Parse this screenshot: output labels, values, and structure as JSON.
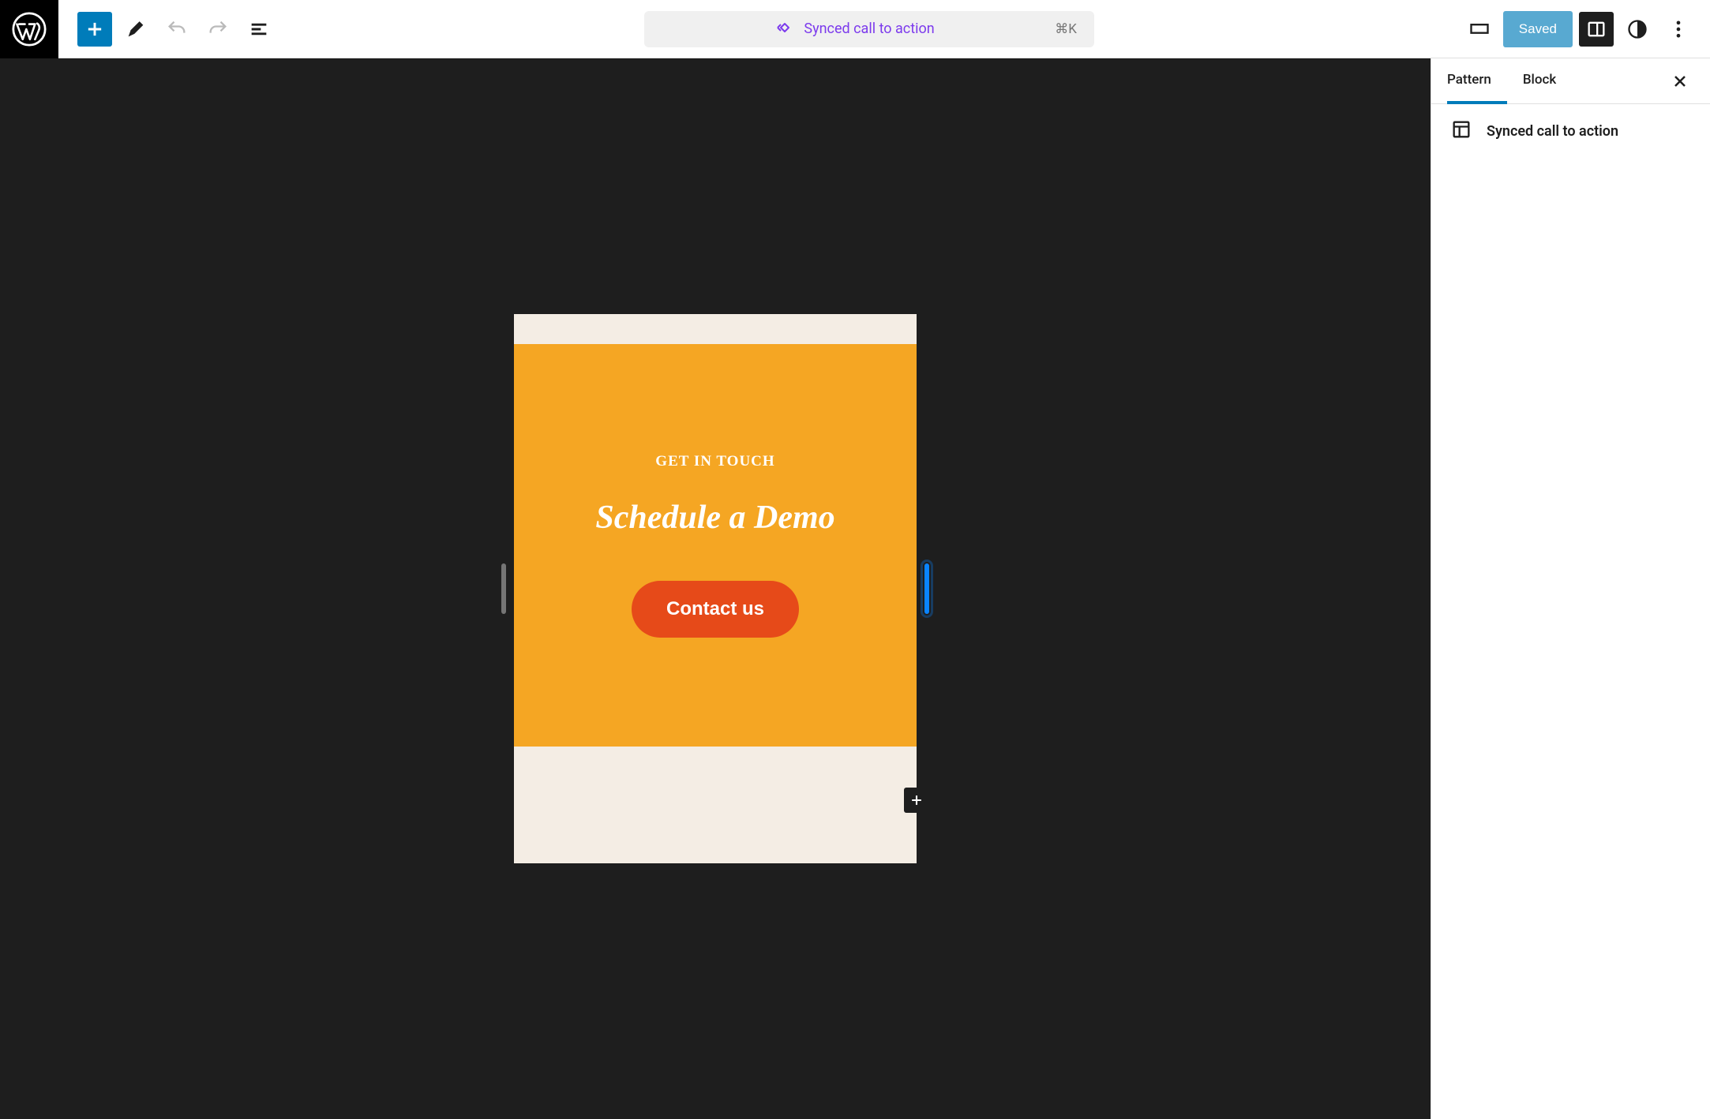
{
  "toolbar": {
    "command_label": "Synced call to action",
    "command_shortcut": "⌘K",
    "saved_label": "Saved"
  },
  "inspector": {
    "tabs": {
      "pattern": "Pattern",
      "block": "Block"
    },
    "item_label": "Synced call to action"
  },
  "canvas": {
    "eyebrow": "GET IN TOUCH",
    "heading": "Schedule a Demo",
    "button_label": "Contact us"
  },
  "colors": {
    "primary": "#007cba",
    "synced": "#7c3aed",
    "cta_bg": "#f5a623",
    "cta_button": "#e64a19",
    "canvas_bg": "#1e1e1e"
  }
}
